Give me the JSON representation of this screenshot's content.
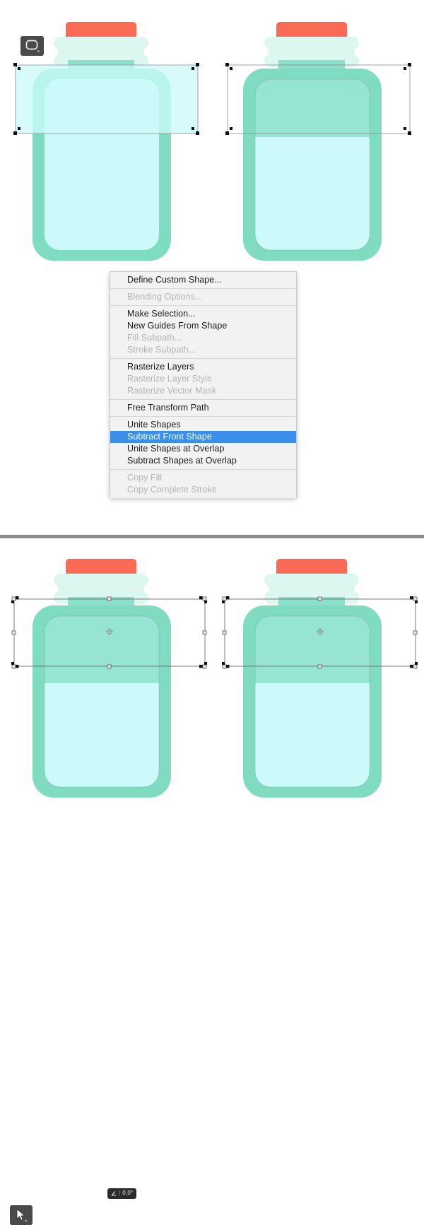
{
  "app": {
    "document_type": "vector-shape-editor",
    "canvas_background": "#ffffff"
  },
  "colors": {
    "cap_red": "#FA6A55",
    "thread_light": "#DCF7F0",
    "neck_teal": "#8CE0CB",
    "body_outer": "#7FDCC0",
    "body_fill_light": "#CCFAFA",
    "body_fill_medium": "#96E4D3",
    "overlay_rect_fill": "#CCFAFA",
    "path_stroke": "#7a7a7a",
    "handle_fill": "#1a1a1a",
    "menu_bg": "#f2f2f2",
    "menu_highlight": "#3b8fea",
    "menu_text": "#1a1a1a",
    "menu_text_disabled": "#b4b4b4",
    "badge_bg": "#4a4a4a",
    "tooltip_bg": "#2b2b2b",
    "divider_gray": "#8c8c8c"
  },
  "panels": {
    "top": {
      "name": "before-subtract",
      "bottles": [
        {
          "id": "bottle-top-left",
          "state": "overlap-rectangle-selected",
          "liquid_level": "full-light",
          "has_overlay_rect": true
        },
        {
          "id": "bottle-top-right",
          "state": "after-subtract-preview",
          "liquid_level": "split",
          "has_overlay_rect": false
        }
      ]
    },
    "bottom": {
      "name": "after-subtract-transform",
      "bottles": [
        {
          "id": "bottle-bottom-left",
          "state": "free-transform-active",
          "liquid_level": "split",
          "has_angle_tooltip": true
        },
        {
          "id": "bottle-bottom-right",
          "state": "free-transform-active",
          "liquid_level": "split",
          "has_angle_tooltip": false
        }
      ]
    }
  },
  "badges": {
    "shape_tool": {
      "icon": "rounded-rectangle-tool-icon",
      "label": "Rounded Rectangle Tool"
    },
    "move_tool": {
      "icon": "move-arrow-tool-icon",
      "label": "Move Tool"
    }
  },
  "angle_tooltip": {
    "icon": "angle-icon",
    "separator": "|",
    "value": "0,0°"
  },
  "context_menu": {
    "name": "path-context-menu",
    "groups": [
      {
        "items": [
          {
            "label": "Define Custom Shape...",
            "disabled": false,
            "selected": false
          }
        ]
      },
      {
        "items": [
          {
            "label": "Blending Options...",
            "disabled": true,
            "selected": false
          }
        ]
      },
      {
        "items": [
          {
            "label": "Make Selection...",
            "disabled": false,
            "selected": false
          },
          {
            "label": "New Guides From Shape",
            "disabled": false,
            "selected": false
          },
          {
            "label": "Fill Subpath...",
            "disabled": true,
            "selected": false
          },
          {
            "label": "Stroke Subpath...",
            "disabled": true,
            "selected": false
          }
        ]
      },
      {
        "items": [
          {
            "label": "Rasterize Layers",
            "disabled": false,
            "selected": false
          },
          {
            "label": "Rasterize Layer Style",
            "disabled": true,
            "selected": false
          },
          {
            "label": "Rasterize Vector Mask",
            "disabled": true,
            "selected": false
          }
        ]
      },
      {
        "items": [
          {
            "label": "Free Transform Path",
            "disabled": false,
            "selected": false
          }
        ]
      },
      {
        "items": [
          {
            "label": "Unite Shapes",
            "disabled": false,
            "selected": false
          },
          {
            "label": "Subtract Front Shape",
            "disabled": false,
            "selected": true
          },
          {
            "label": "Unite Shapes at Overlap",
            "disabled": false,
            "selected": false
          },
          {
            "label": "Subtract Shapes at Overlap",
            "disabled": false,
            "selected": false
          }
        ]
      },
      {
        "items": [
          {
            "label": "Copy Fill",
            "disabled": true,
            "selected": false
          },
          {
            "label": "Copy Complete Stroke",
            "disabled": true,
            "selected": false
          }
        ]
      }
    ]
  }
}
